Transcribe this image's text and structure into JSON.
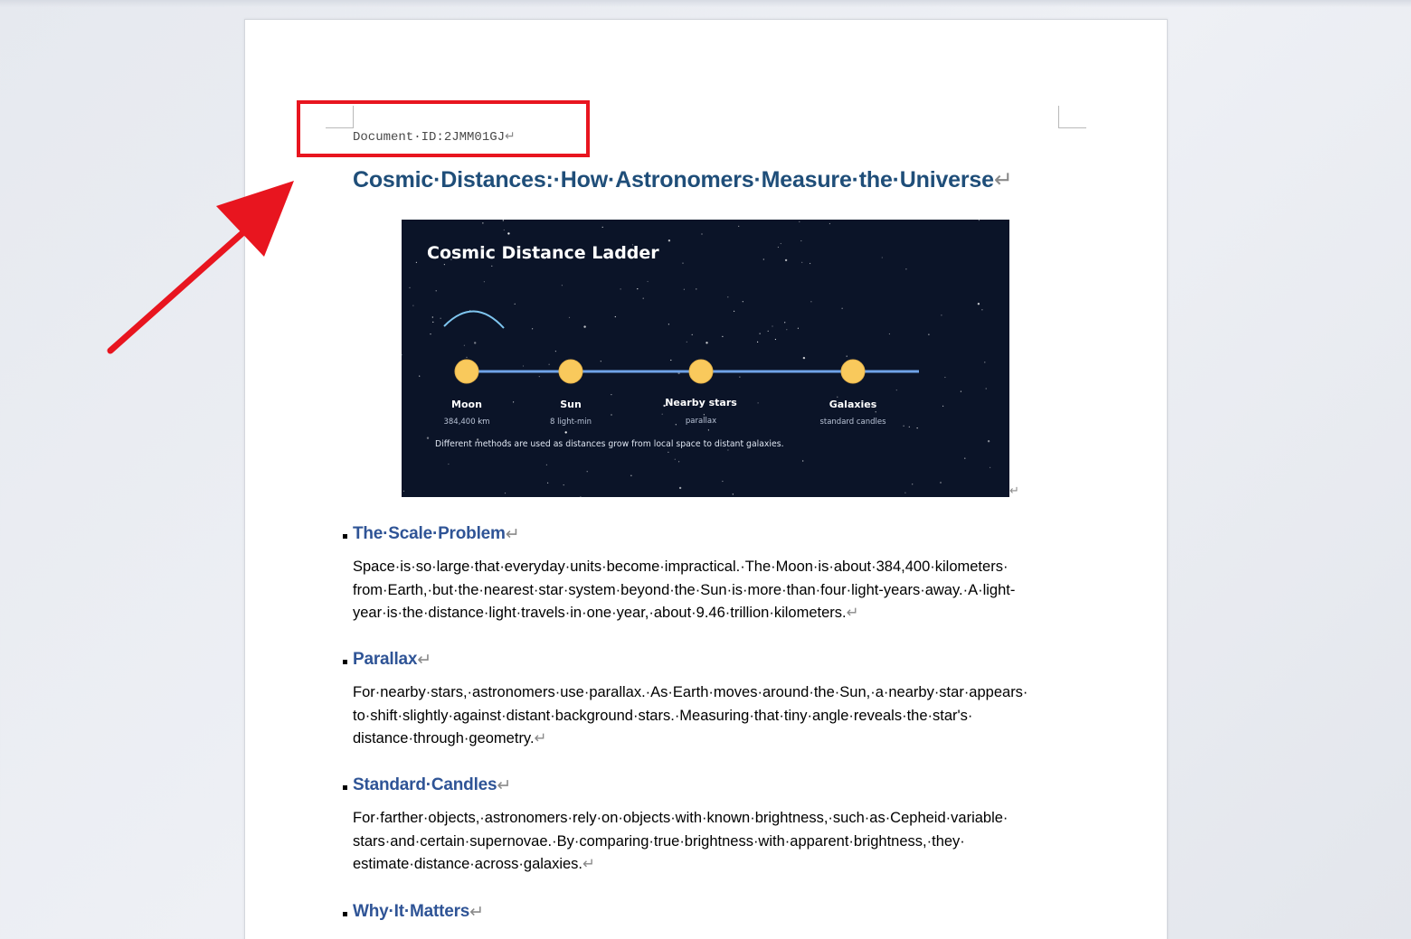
{
  "document": {
    "id_label": "Document·ID:2JMM01GJ",
    "title": "Cosmic·Distances:·How·Astronomers·Measure·the·Universe",
    "return_mark": "↵"
  },
  "figure": {
    "title": "Cosmic Distance Ladder",
    "caption": "Different methods are used as distances grow from local space to distant galaxies.",
    "stops": [
      {
        "name": "Moon",
        "detail": "384,400 km"
      },
      {
        "name": "Sun",
        "detail": "8 light-min"
      },
      {
        "name": "Nearby stars",
        "detail": "parallax"
      },
      {
        "name": "Galaxies",
        "detail": "standard candles"
      }
    ],
    "colors": {
      "background": "#0b1428",
      "line": "#6fa3e8",
      "node": "#f9c95c",
      "arc": "#7fc6f0"
    }
  },
  "sections": [
    {
      "heading": "The·Scale·Problem",
      "lines": [
        "Space·is·so·large·that·everyday·units·become·impractical.·The·Moon·is·about·384,400·kilometers·",
        "from·Earth,·but·the·nearest·star·system·beyond·the·Sun·is·more·than·four·light-years·away.·A·light-",
        "year·is·the·distance·light·travels·in·one·year,·about·9.46·trillion·kilometers."
      ]
    },
    {
      "heading": "Parallax",
      "lines": [
        "For·nearby·stars,·astronomers·use·parallax.·As·Earth·moves·around·the·Sun,·a·nearby·star·appears·",
        "to·shift·slightly·against·distant·background·stars.·Measuring·that·tiny·angle·reveals·the·star's·",
        "distance·through·geometry."
      ]
    },
    {
      "heading": "Standard·Candles",
      "lines": [
        "For·farther·objects,·astronomers·rely·on·objects·with·known·brightness,·such·as·Cepheid·variable·",
        "stars·and·certain·supernovae.·By·comparing·true·brightness·with·apparent·brightness,·they·",
        "estimate·distance·across·galaxies."
      ]
    },
    {
      "heading": "Why·It·Matters",
      "lines": []
    }
  ],
  "annotation": {
    "color": "#e8151f",
    "icon": "arrow-icon"
  }
}
